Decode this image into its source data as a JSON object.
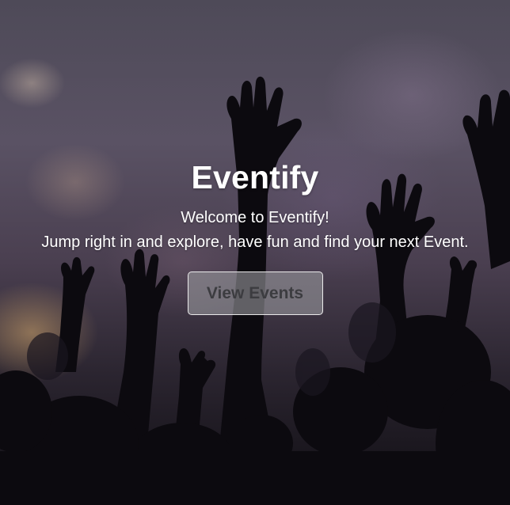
{
  "hero": {
    "title": "Eventify",
    "subtitle": "Welcome to Eventify!",
    "tagline": "Jump right in and explore, have fun and find your next Event.",
    "cta_label": "View Events",
    "background_image": "concert crowd with raised hands silhouetted against stage lights"
  }
}
